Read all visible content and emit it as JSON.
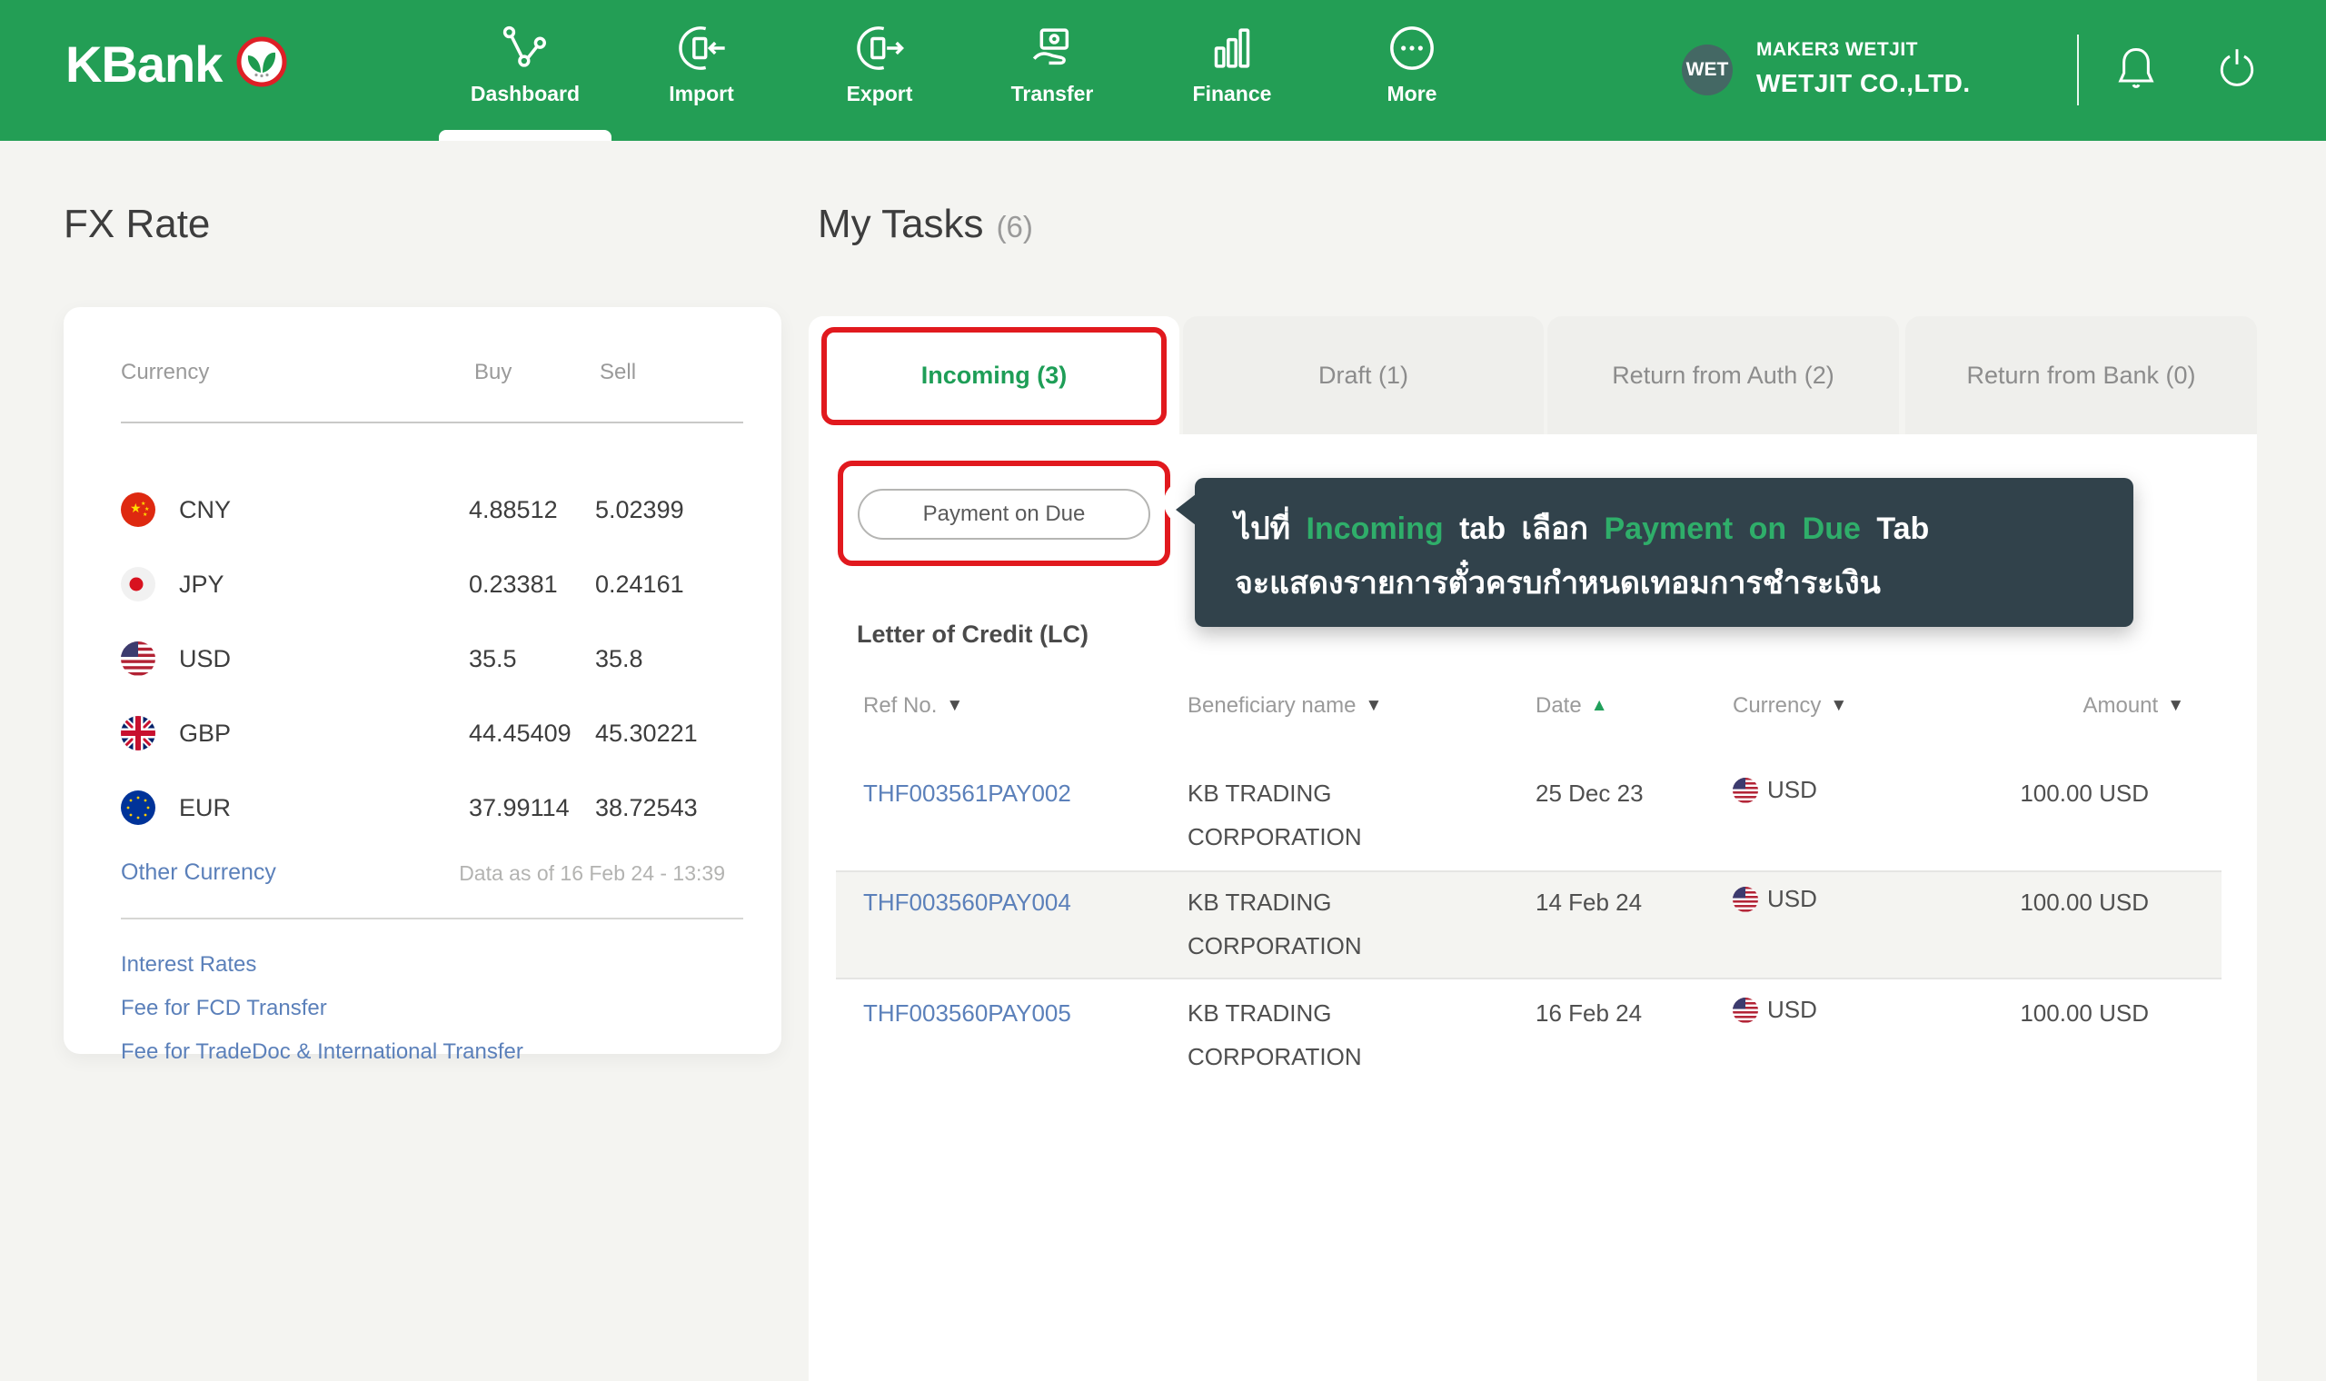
{
  "colors": {
    "brand_green": "#239e55",
    "accent_red": "#e1191e",
    "link_blue": "#5b80ba",
    "tooltip_bg": "#31424b",
    "tooltip_green": "#2fae6a",
    "active_tab_green": "#1e9e57"
  },
  "navbar": {
    "logo_text": "KBank",
    "items": [
      {
        "label": "Dashboard",
        "active": true
      },
      {
        "label": "Import"
      },
      {
        "label": "Export"
      },
      {
        "label": "Transfer"
      },
      {
        "label": "Finance"
      },
      {
        "label": "More"
      }
    ],
    "user": {
      "avatar": "WET",
      "name": "MAKER3 WETJIT",
      "company": "WETJIT CO.,LTD."
    }
  },
  "fx": {
    "title": "FX Rate",
    "col_currency": "Currency",
    "col_buy": "Buy",
    "col_sell": "Sell",
    "rows": [
      {
        "code": "CNY",
        "buy": "4.88512",
        "sell": "5.02399"
      },
      {
        "code": "JPY",
        "buy": "0.23381",
        "sell": "0.24161"
      },
      {
        "code": "USD",
        "buy": "35.5",
        "sell": "35.8"
      },
      {
        "code": "GBP",
        "buy": "44.45409",
        "sell": "45.30221"
      },
      {
        "code": "EUR",
        "buy": "37.99114",
        "sell": "38.72543"
      }
    ],
    "other_currency_link": "Other Currency",
    "data_as_of": "Data as of 16 Feb 24 - 13:39",
    "links": {
      "interest": "Interest Rates",
      "fcd": "Fee for FCD Transfer",
      "tradedoc": "Fee for TradeDoc & International Transfer"
    }
  },
  "tasks": {
    "title": "My Tasks",
    "count": "(6)",
    "tabs": {
      "incoming": "Incoming (3)",
      "draft": "Draft (1)",
      "return_auth": "Return from Auth (2)",
      "return_bank": "Return from Bank (0)"
    },
    "payment_on_due_button": "Payment on Due",
    "tooltip": {
      "t1": "ไปที่",
      "t2": "Incoming",
      "t3": "tab เลือก",
      "t4": "Payment on Due",
      "t5": "Tab",
      "line2": "จะแสดงรายการตั๋วครบกำหนดเทอมการชำระเงิน"
    },
    "section_title": "Letter of Credit (LC)",
    "table": {
      "h_ref": "Ref No.",
      "h_beneficiary": "Beneficiary name",
      "h_date": "Date",
      "h_currency": "Currency",
      "h_amount": "Amount",
      "rows": [
        {
          "ref": "THF003561PAY002",
          "name1": "KB TRADING",
          "name2": "CORPORATION",
          "date": "25 Dec 23",
          "currency": "USD",
          "amount": "100.00 USD"
        },
        {
          "ref": "THF003560PAY004",
          "name1": "KB TRADING",
          "name2": "CORPORATION",
          "date": "14 Feb 24",
          "currency": "USD",
          "amount": "100.00 USD"
        },
        {
          "ref": "THF003560PAY005",
          "name1": "KB TRADING",
          "name2": "CORPORATION",
          "date": "16 Feb 24",
          "currency": "USD",
          "amount": "100.00 USD"
        }
      ]
    }
  }
}
